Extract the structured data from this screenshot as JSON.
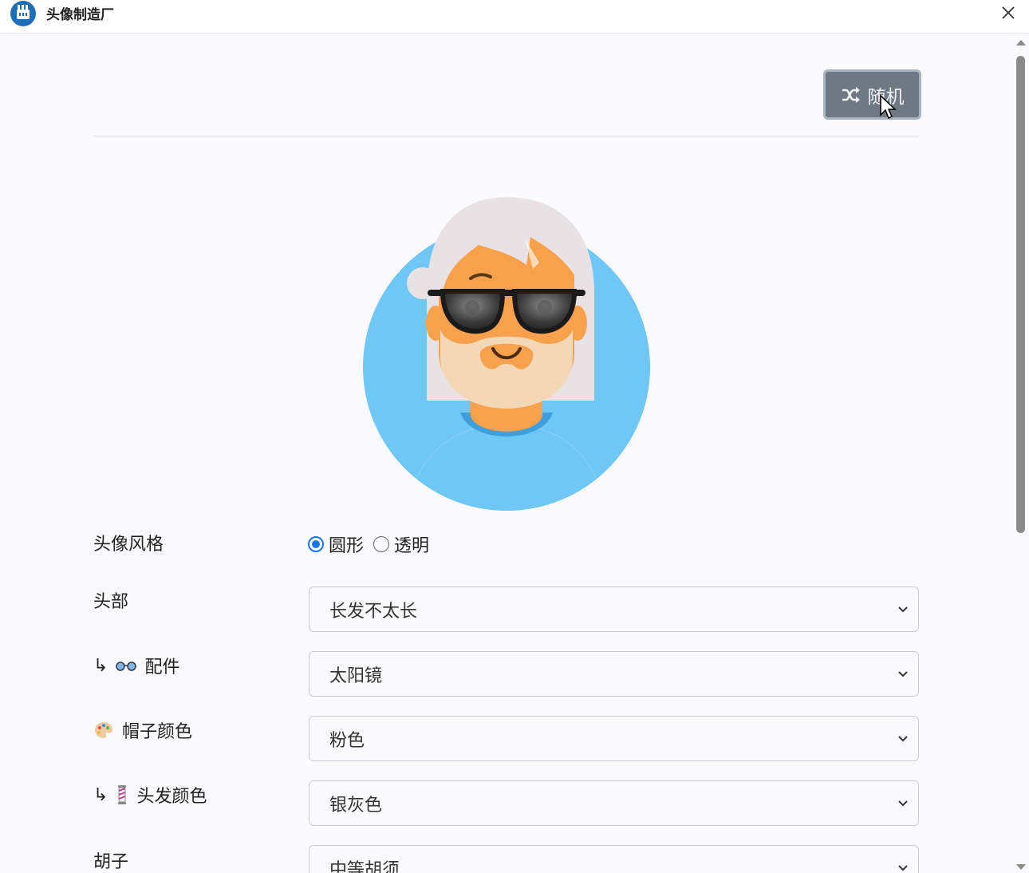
{
  "window": {
    "title": "头像制造厂",
    "app_icon": "factory-icon",
    "close_icon": "close-icon"
  },
  "toolbar": {
    "random_label": "随机",
    "random_icon": "shuffle-icon"
  },
  "avatar": {
    "style": "圆形",
    "background_color": "#6ec7f5",
    "skin_color": "#f7a14c",
    "hair_color": "#e8e2e4",
    "accessory": "sunglasses",
    "shirt_color": "#6ec7f5"
  },
  "form": {
    "style": {
      "label": "头像风格",
      "options": [
        {
          "label": "圆形",
          "checked": true
        },
        {
          "label": "透明",
          "checked": false
        }
      ]
    },
    "rows": [
      {
        "label": "头部",
        "prefix": "",
        "emoji": "",
        "value": "长发不太长"
      },
      {
        "label": "配件",
        "prefix": "↳",
        "emoji": "👓",
        "value": "太阳镜"
      },
      {
        "label": "帽子颜色",
        "prefix": "",
        "emoji": "🎨",
        "value": "粉色"
      },
      {
        "label": "头发颜色",
        "prefix": "↳",
        "emoji": "💈",
        "value": "银灰色"
      },
      {
        "label": "胡子",
        "prefix": "",
        "emoji": "",
        "value": "中等胡须"
      }
    ]
  }
}
